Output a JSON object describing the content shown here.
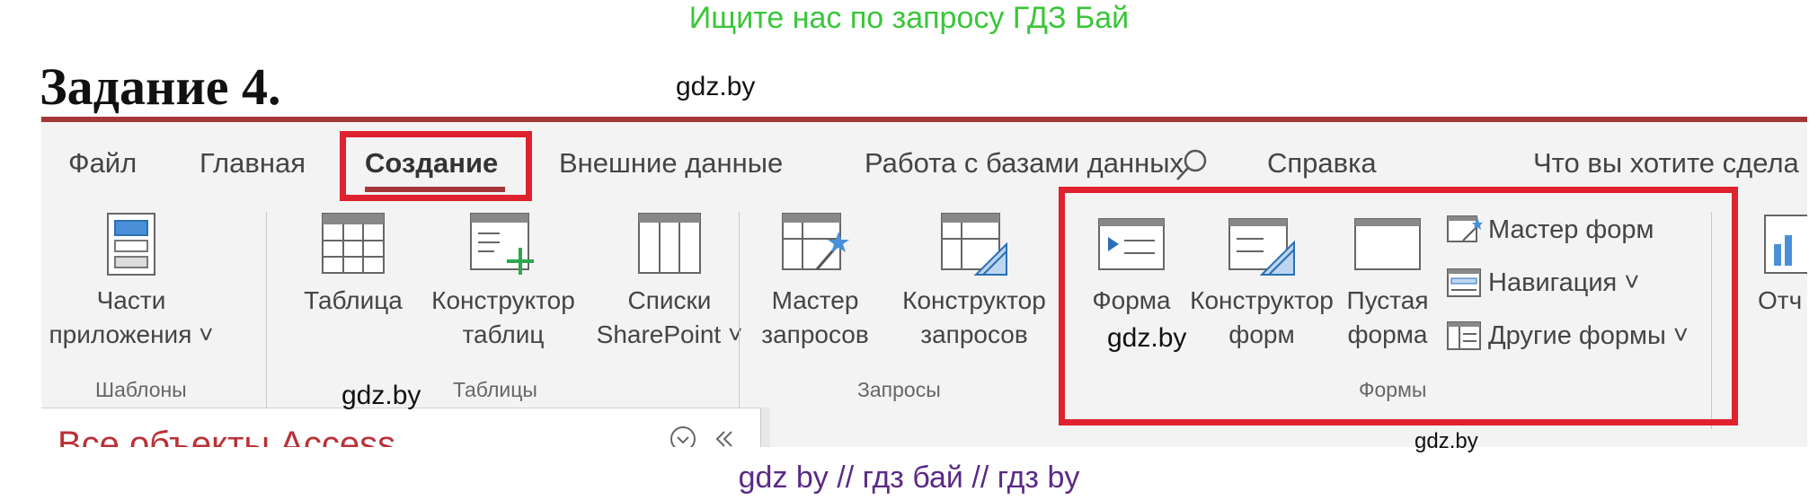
{
  "banner": "Ищите нас по запросу ГДЗ Бай",
  "task_title": "Задание 4.",
  "watermark": "gdz.by",
  "footer": "gdz by  //  гдз бай  //  гдз by",
  "ribbon": {
    "tabs": [
      "Файл",
      "Главная",
      "Создание",
      "Внешние данные",
      "Работа с базами данных",
      "Справка"
    ],
    "active_tab": "Создание",
    "search_placeholder": "Что вы хотите сдела",
    "groups": {
      "templates": {
        "label": "Шаблоны",
        "app_parts": [
          "Части",
          "приложения ˅"
        ]
      },
      "tables": {
        "label": "Таблицы",
        "table": "Таблица",
        "designer": [
          "Конструктор",
          "таблиц"
        ],
        "sharepoint": [
          "Списки",
          "SharePoint ˅"
        ]
      },
      "queries": {
        "label": "Запросы",
        "wizard": [
          "Мастер",
          "запросов"
        ],
        "designer": [
          "Конструктор",
          "запросов"
        ]
      },
      "forms": {
        "label": "Формы",
        "form": "Форма",
        "designer": [
          "Конструктор",
          "форм"
        ],
        "blank": [
          "Пустая",
          "форма"
        ],
        "wizard": "Мастер форм",
        "navigation": "Навигация ˅",
        "more": "Другие формы ˅"
      },
      "reports_partial": "Отч"
    }
  },
  "nav_pane_title": "Все объекты Access",
  "colors": {
    "highlight": "#e0212f",
    "accent": "#a4373a",
    "banner": "#3ac63a",
    "footer": "#5b2a86"
  }
}
